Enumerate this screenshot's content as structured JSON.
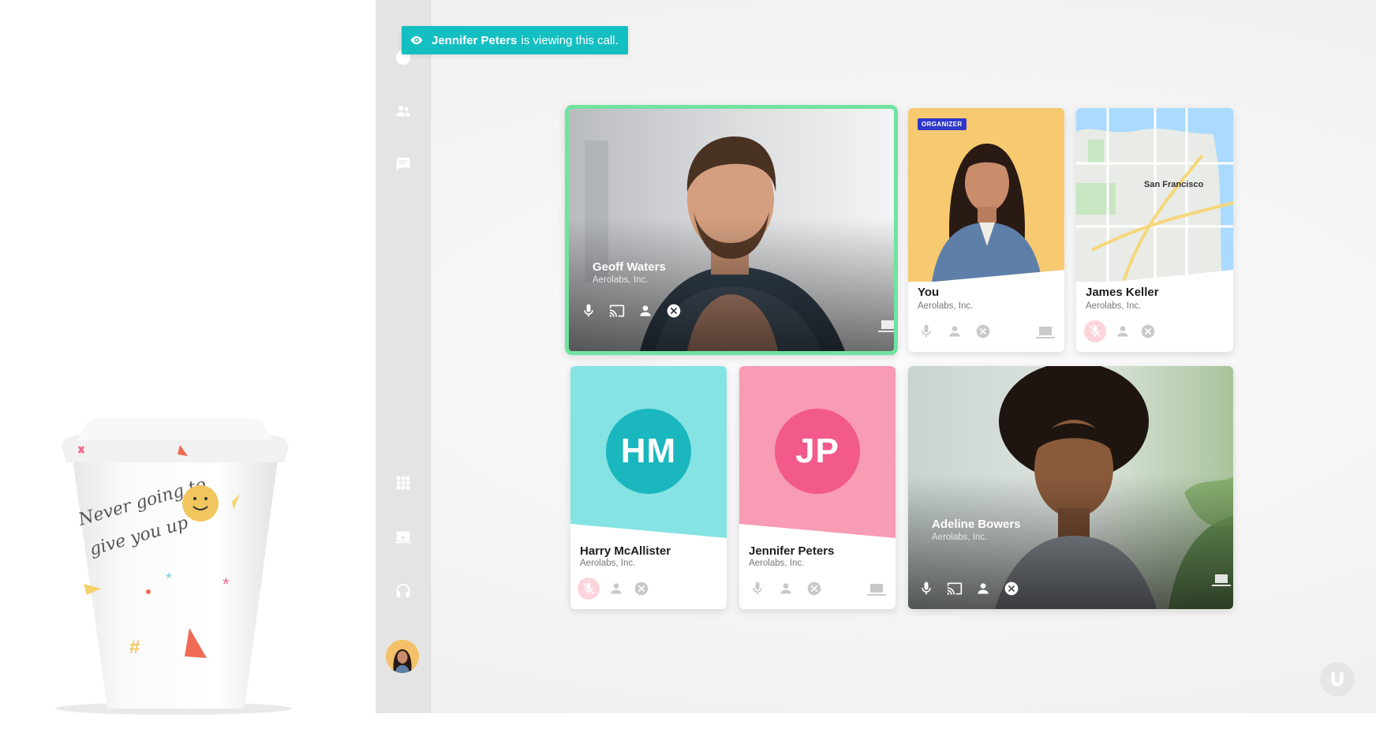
{
  "toast": {
    "viewer_name": "Jennifer Peters",
    "message": "is viewing this call."
  },
  "sidebar": {
    "top_icons": [
      "info-icon",
      "people-icon",
      "chat-icon"
    ],
    "bottom_icons": [
      "grid-icon",
      "screen-share-icon",
      "headset-icon"
    ]
  },
  "cup": {
    "line1": "Never going to",
    "line2": "give you up"
  },
  "participants": [
    {
      "name": "Geoff Waters",
      "company": "Aerolabs, Inc.",
      "active_speaker": true
    },
    {
      "name": "You",
      "company": "Aerolabs, Inc.",
      "badge": "ORGANIZER"
    },
    {
      "name": "James Keller",
      "company": "Aerolabs, Inc.",
      "map_label": "San Francisco",
      "muted": true
    },
    {
      "name": "Harry McAllister",
      "company": "Aerolabs, Inc.",
      "initials": "HM",
      "muted": true
    },
    {
      "name": "Jennifer Peters",
      "company": "Aerolabs, Inc.",
      "initials": "JP"
    },
    {
      "name": "Adeline Bowers",
      "company": "Aerolabs, Inc."
    }
  ],
  "colors": {
    "accent_teal": "#14bfc2",
    "active_border": "#6fe3a0",
    "organizer_badge": "#2f37c9",
    "tile_you_bg": "#f7ca72",
    "tile_hm_bg": "#86e3e3",
    "circle_hm": "#1bb7bf",
    "tile_jp_bg": "#f89bb5",
    "circle_jp": "#f25a8a"
  }
}
